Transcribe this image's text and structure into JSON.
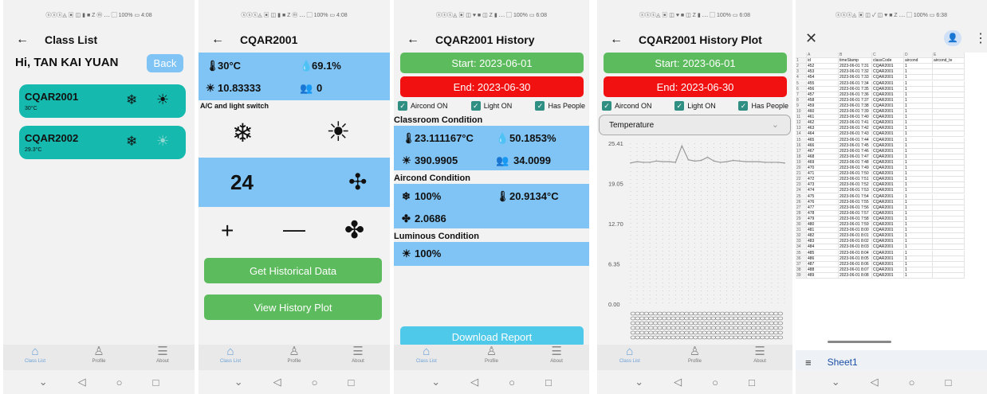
{
  "status": {
    "s1": "ⓢⓢⓢ◬ ▣ ◫ ▮ ■ Z ⓜ ⋯   ▢ 100% ▭ 4:08",
    "s2": "ⓢⓢⓢ◬ ▣ ◫ ▮ ■ Z ⓜ ⋯   ▢ 100% ▭ 4:08",
    "s3": "ⓢⓢⓢ◬ ▣ ◫ ♥ ■ ◫ Z ▮ ⋯   ▢ 100% ▭ 6:08",
    "s4": "ⓢⓢⓢ◬ ▣ ◫ ♥ ■ ◫ Z ▮ ⋯   ▢ 100% ▭ 6:08",
    "s5": "ⓢⓢⓢ◬ ▣ ◫ ✓ ◫ ♥ ■ Z ⋯   ▢ 100% ▭ 6:38"
  },
  "nav": {
    "class_list": "Class List",
    "profile": "Profile",
    "about": "About"
  },
  "s1": {
    "title": "Class List",
    "greeting": "Hi, TAN KAI YUAN",
    "back": "Back",
    "classes": [
      {
        "name": "CQAR2001",
        "temp": "30°C"
      },
      {
        "name": "CQAR2002",
        "temp": "29.3°C"
      }
    ]
  },
  "s2": {
    "title": "CQAR2001",
    "temp": "30°C",
    "hum": "69.1%",
    "lux": "10.83333",
    "people": "0",
    "switch_label": "A/C and light switch",
    "setpoint": "24",
    "hist_btn": "Get Historical Data",
    "plot_btn": "View History Plot"
  },
  "s3": {
    "title": "CQAR2001 History",
    "start": "Start: 2023-06-01",
    "end": "End: 2023-06-30",
    "aircond_on": "Aircond ON",
    "light_on": "Light ON",
    "has_people": "Has People",
    "classroom_h": "Classroom Condition",
    "t": "23.111167°C",
    "h": "50.1853%",
    "l": "390.9905",
    "p": "34.0099",
    "aircond_h": "Aircond Condition",
    "ac_pct": "100%",
    "ac_t": "20.9134°C",
    "fan": "2.0686",
    "lum_h": "Luminous Condition",
    "lum": "100%",
    "download": "Download Report"
  },
  "s4": {
    "title": "CQAR2001 History Plot",
    "start": "Start: 2023-06-01",
    "end": "End: 2023-06-30",
    "aircond_on": "Aircond ON",
    "light_on": "Light ON",
    "has_people": "Has People",
    "dropdown": "Temperature",
    "chart_data": {
      "type": "line",
      "ylim": [
        0,
        25.41
      ],
      "yticks": [
        "25.41",
        "19.05",
        "12.70",
        "6.35",
        "0.00"
      ],
      "series": [
        {
          "values": [
            22.3,
            22.5,
            22.4,
            22.4,
            22.6,
            22.5,
            22.5,
            22.4,
            25.0,
            22.8,
            22.6,
            22.7,
            23.2,
            22.6,
            22.4,
            22.5,
            22.7,
            22.6,
            22.5,
            22.5,
            22.5,
            22.4,
            22.4,
            22.4,
            22.3
          ]
        }
      ]
    }
  },
  "s5": {
    "sheet_tab": "Sheet1",
    "cols": [
      "A",
      "B",
      "C",
      "D",
      "E"
    ],
    "headers": [
      "id",
      "timeStamp",
      "classCode",
      "aircond",
      "aircond_te"
    ],
    "rows": [
      [
        "452",
        "2023-06-01 7:31",
        "CQAR2001",
        "1"
      ],
      [
        "453",
        "2023-06-01 7:32",
        "CQAR2001",
        "1"
      ],
      [
        "454",
        "2023-06-01 7:33",
        "CQAR2001",
        "1"
      ],
      [
        "455",
        "2023-06-01 7:34",
        "CQAR2001",
        "1"
      ],
      [
        "456",
        "2023-06-01 7:35",
        "CQAR2001",
        "1"
      ],
      [
        "457",
        "2023-06-01 7:36",
        "CQAR2001",
        "1"
      ],
      [
        "458",
        "2023-06-01 7:37",
        "CQAR2001",
        "1"
      ],
      [
        "459",
        "2023-06-01 7:38",
        "CQAR2001",
        "1"
      ],
      [
        "460",
        "2023-06-01 7:39",
        "CQAR2001",
        "1"
      ],
      [
        "461",
        "2023-06-01 7:40",
        "CQAR2001",
        "1"
      ],
      [
        "462",
        "2023-06-01 7:41",
        "CQAR2001",
        "1"
      ],
      [
        "463",
        "2023-06-01 7:42",
        "CQAR2001",
        "1"
      ],
      [
        "464",
        "2023-06-01 7:43",
        "CQAR2001",
        "1"
      ],
      [
        "465",
        "2023-06-01 7:44",
        "CQAR2001",
        "1"
      ],
      [
        "466",
        "2023-06-01 7:45",
        "CQAR2001",
        "1"
      ],
      [
        "467",
        "2023-06-01 7:46",
        "CQAR2001",
        "1"
      ],
      [
        "468",
        "2023-06-01 7:47",
        "CQAR2001",
        "1"
      ],
      [
        "469",
        "2023-06-01 7:48",
        "CQAR2001",
        "1"
      ],
      [
        "470",
        "2023-06-01 7:49",
        "CQAR2001",
        "1"
      ],
      [
        "471",
        "2023-06-01 7:50",
        "CQAR2001",
        "1"
      ],
      [
        "472",
        "2023-06-01 7:51",
        "CQAR2001",
        "1"
      ],
      [
        "473",
        "2023-06-01 7:52",
        "CQAR2001",
        "1"
      ],
      [
        "474",
        "2023-06-01 7:53",
        "CQAR2001",
        "1"
      ],
      [
        "475",
        "2023-06-01 7:54",
        "CQAR2001",
        "1"
      ],
      [
        "476",
        "2023-06-01 7:55",
        "CQAR2001",
        "1"
      ],
      [
        "477",
        "2023-06-01 7:56",
        "CQAR2001",
        "1"
      ],
      [
        "478",
        "2023-06-01 7:57",
        "CQAR2001",
        "1"
      ],
      [
        "479",
        "2023-06-01 7:58",
        "CQAR2001",
        "1"
      ],
      [
        "480",
        "2023-06-01 7:59",
        "CQAR2001",
        "1"
      ],
      [
        "481",
        "2023-06-01 8:00",
        "CQAR2001",
        "1"
      ],
      [
        "482",
        "2023-06-01 8:01",
        "CQAR2001",
        "1"
      ],
      [
        "483",
        "2023-06-01 8:02",
        "CQAR2001",
        "1"
      ],
      [
        "484",
        "2023-06-01 8:03",
        "CQAR2001",
        "1"
      ],
      [
        "485",
        "2023-06-01 8:04",
        "CQAR2001",
        "1"
      ],
      [
        "486",
        "2023-06-01 8:05",
        "CQAR2001",
        "1"
      ],
      [
        "487",
        "2023-06-01 8:06",
        "CQAR2001",
        "1"
      ],
      [
        "488",
        "2023-06-01 8:07",
        "CQAR2001",
        "1"
      ],
      [
        "489",
        "2023-06-01 8:08",
        "CQAR2001",
        "1"
      ]
    ]
  },
  "colors": {
    "teal": "#15b9ad",
    "blue": "#7fc4f5",
    "green": "#5cbb5c",
    "red": "#f21111",
    "cyan": "#4fc9e9"
  }
}
